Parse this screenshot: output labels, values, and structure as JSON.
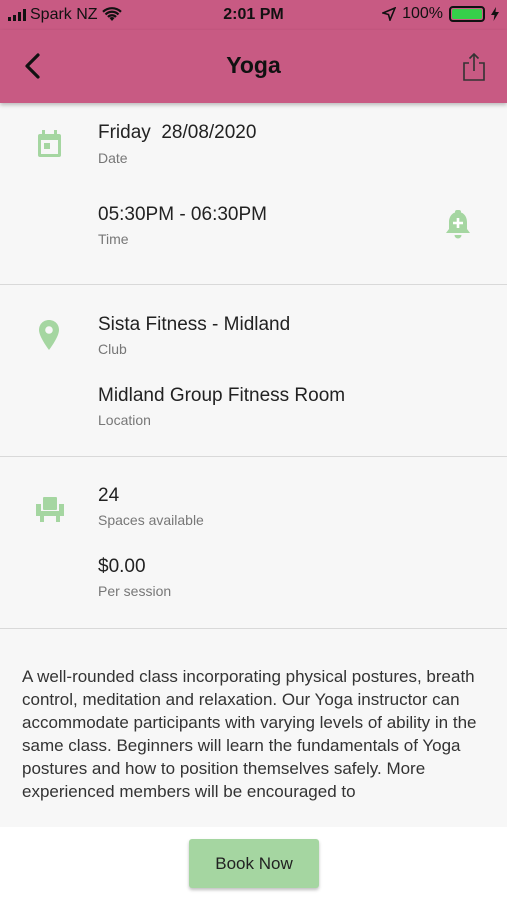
{
  "status_bar": {
    "carrier": "Spark NZ",
    "time": "2:01 PM",
    "battery": "100%"
  },
  "header": {
    "title": "Yoga"
  },
  "schedule": {
    "date_value": "Friday  28/08/2020",
    "date_label": "Date",
    "time_value": "05:30PM - 06:30PM",
    "time_label": "Time"
  },
  "venue": {
    "club_value": "Sista Fitness - Midland",
    "club_label": "Club",
    "location_value": "Midland Group Fitness Room",
    "location_label": "Location"
  },
  "capacity": {
    "spaces_value": "24",
    "spaces_label": "Spaces available",
    "price_value": "$0.00",
    "price_label": "Per session"
  },
  "description": "A well-rounded class incorporating physical postures, breath control, meditation and relaxation. Our Yoga instructor can accommodate participants with varying levels of ability in the same class. Beginners will learn the fundamentals of Yoga postures and how to position themselves safely. More experienced members will be encouraged to",
  "actions": {
    "book_label": "Book Now"
  },
  "colors": {
    "accent": "#c85a83",
    "icon_green": "#a5d6a1",
    "button_green": "#a5d6a1"
  }
}
